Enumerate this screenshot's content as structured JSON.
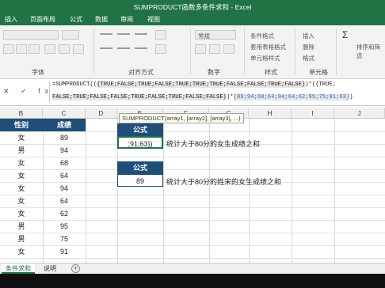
{
  "window": {
    "title": "SUMPRODUCT函数多条件求和 - Excel"
  },
  "ribbon_tabs": [
    "插入",
    "页面布局",
    "公式",
    "数据",
    "审阅",
    "视图"
  ],
  "ribbon_groups": [
    "字体",
    "对齐方式",
    "数字",
    "样式",
    "单元格"
  ],
  "ribbon_items": {
    "number_format": "常规",
    "conditional_format": "条件格式",
    "table_format": "套用表格格式",
    "cell_styles": "单元格样式",
    "insert": "插入",
    "delete": "删除",
    "format": "格式",
    "sort_filter": "排序和筛选"
  },
  "formula_bar": {
    "icons": "✕ ✓ fx",
    "line1_prefix": "=SUMPRODUCT((",
    "line1_bool": "{TRUE;FALSE;TRUE;FALSE;TRUE;TRUE;TRUE;FALSE;FALSE;TRUE;FALSE}",
    "line1_suffix": ")*({TRUE;",
    "line2_bool": "FALSE;TRUE;FALSE;FALSE;TRUE;FALSE;TRUE;FALSE;FALSE}",
    "line2_mid": ")*",
    "line2_nums": "{89;94;68;64;94;64;62;95;75;91;63}",
    "line2_suffix": ")"
  },
  "tooltip": "SUMPRODUCT(array1, [array2], [array3], ...)",
  "columns": [
    "B",
    "C",
    "D",
    "E",
    "F",
    "G",
    "H",
    "I",
    "J"
  ],
  "table": {
    "headers": [
      "性别",
      "成绩"
    ],
    "rows": [
      [
        "女",
        "89"
      ],
      [
        "男",
        "94"
      ],
      [
        "女",
        "68"
      ],
      [
        "女",
        "64"
      ],
      [
        "女",
        "94"
      ],
      [
        "女",
        "64"
      ],
      [
        "女",
        "62"
      ],
      [
        "男",
        "95"
      ],
      [
        "男",
        "75"
      ],
      [
        "女",
        "91"
      ]
    ]
  },
  "formula_box_1": {
    "header": "公式",
    "value": ";91;63})",
    "note": "统计大于80分的女生成绩之和"
  },
  "formula_box_2": {
    "header": "公式",
    "value": "89",
    "note": "统计大于80分的姓宋的女生成绩之和"
  },
  "sheet_tabs": [
    "条件求和",
    "说明"
  ],
  "add_sheet": "+",
  "colors": {
    "excel_green": "#217346",
    "header_blue": "#1f4e79"
  }
}
